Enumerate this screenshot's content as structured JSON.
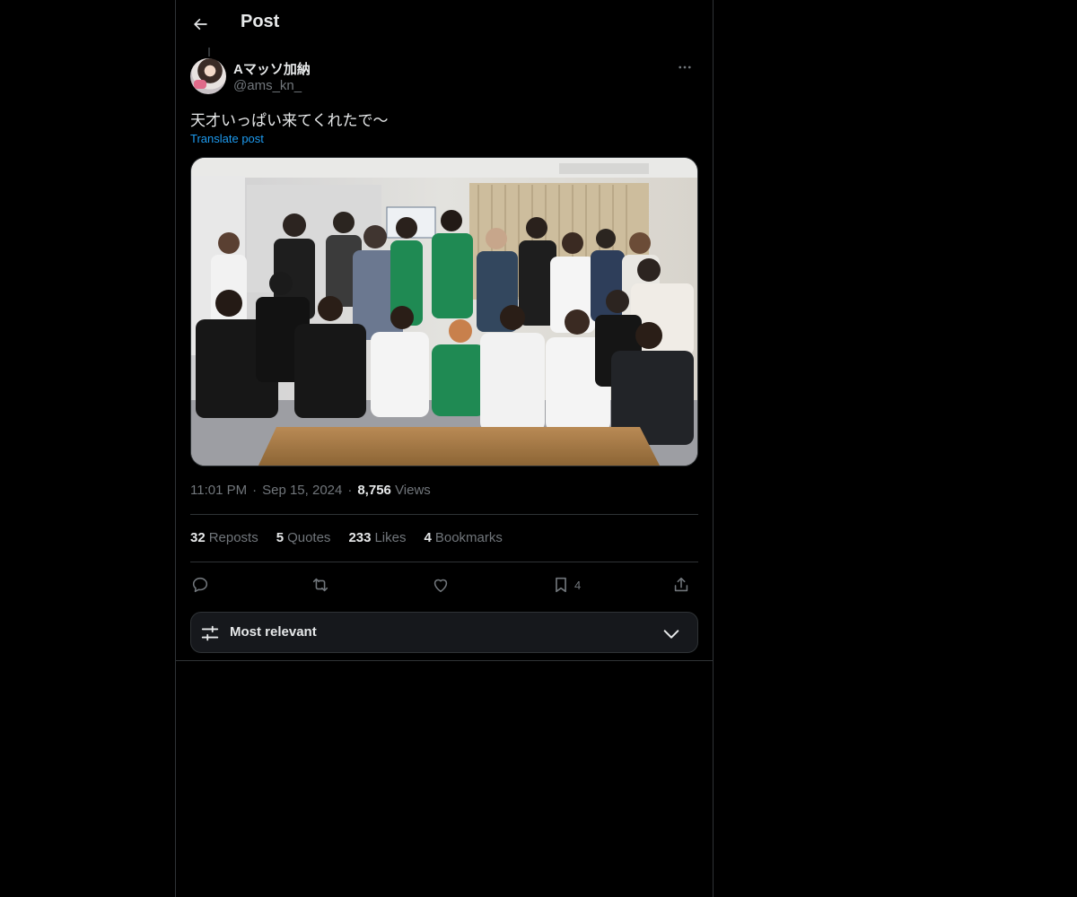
{
  "header": {
    "back_icon": "arrow-left-icon",
    "title": "Post"
  },
  "post": {
    "author": {
      "display_name": "Aマッソ加納",
      "handle": "@ams_kn_"
    },
    "text": "天才いっぱい来てくれたで〜",
    "translate_label": "Translate post",
    "media": {
      "type": "photo",
      "icon": "group-photo"
    },
    "time": "11:01 PM",
    "date": "Sep 15, 2024",
    "views_count": "8,756",
    "views_label": "Views"
  },
  "stats": {
    "reposts_count": "32",
    "reposts_label": "Reposts",
    "quotes_count": "5",
    "quotes_label": "Quotes",
    "likes_count": "233",
    "likes_label": "Likes",
    "bookmarks_count": "4",
    "bookmarks_label": "Bookmarks"
  },
  "actions": {
    "reply_icon": "reply-icon",
    "repost_icon": "repost-icon",
    "like_icon": "heart-icon",
    "bookmark_icon": "bookmark-icon",
    "bookmark_count": "4",
    "share_icon": "share-icon"
  },
  "replies_sort": {
    "label": "Most relevant",
    "icon": "sliders-icon",
    "chevron": "chevron-down-icon"
  },
  "colors": {
    "background": "#000000",
    "text_primary": "#e7e9ea",
    "text_secondary": "#71767b",
    "link": "#1d9bf0",
    "border": "#2f3336",
    "sort_bar": "#16181c"
  }
}
